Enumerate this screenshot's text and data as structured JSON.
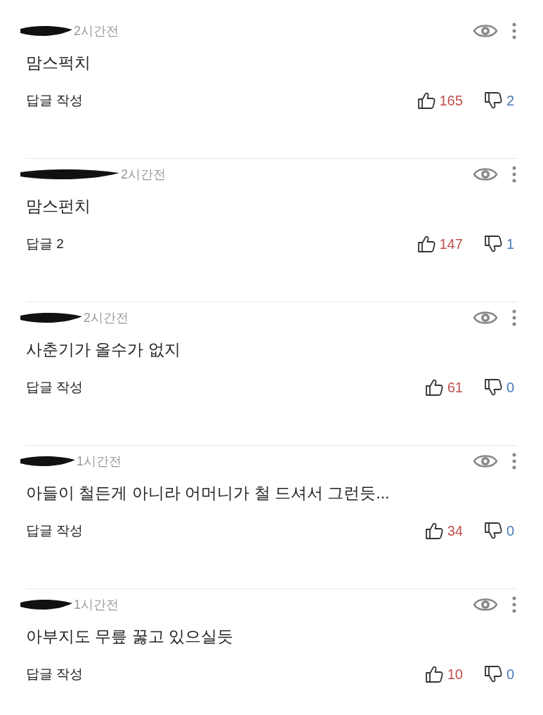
{
  "comments": [
    {
      "time": "2시간전",
      "text": "맘스퍽치",
      "reply": "답글 작성",
      "likes": "165",
      "dislikes": "2"
    },
    {
      "time": "2시간전",
      "text": "맘스펀치",
      "reply": "답글 2",
      "likes": "147",
      "dislikes": "1"
    },
    {
      "time": "2시간전",
      "text": "사춘기가 올수가 없지",
      "reply": "답글 작성",
      "likes": "61",
      "dislikes": "0"
    },
    {
      "time": "1시간전",
      "text": "아들이 철든게 아니라 어머니가 철 드셔서 그런듯...",
      "reply": "답글 작성",
      "likes": "34",
      "dislikes": "0"
    },
    {
      "time": "1시간전",
      "text": "아부지도 무릎 꿇고 있으실듯",
      "reply": "답글 작성",
      "likes": "10",
      "dislikes": "0"
    }
  ]
}
